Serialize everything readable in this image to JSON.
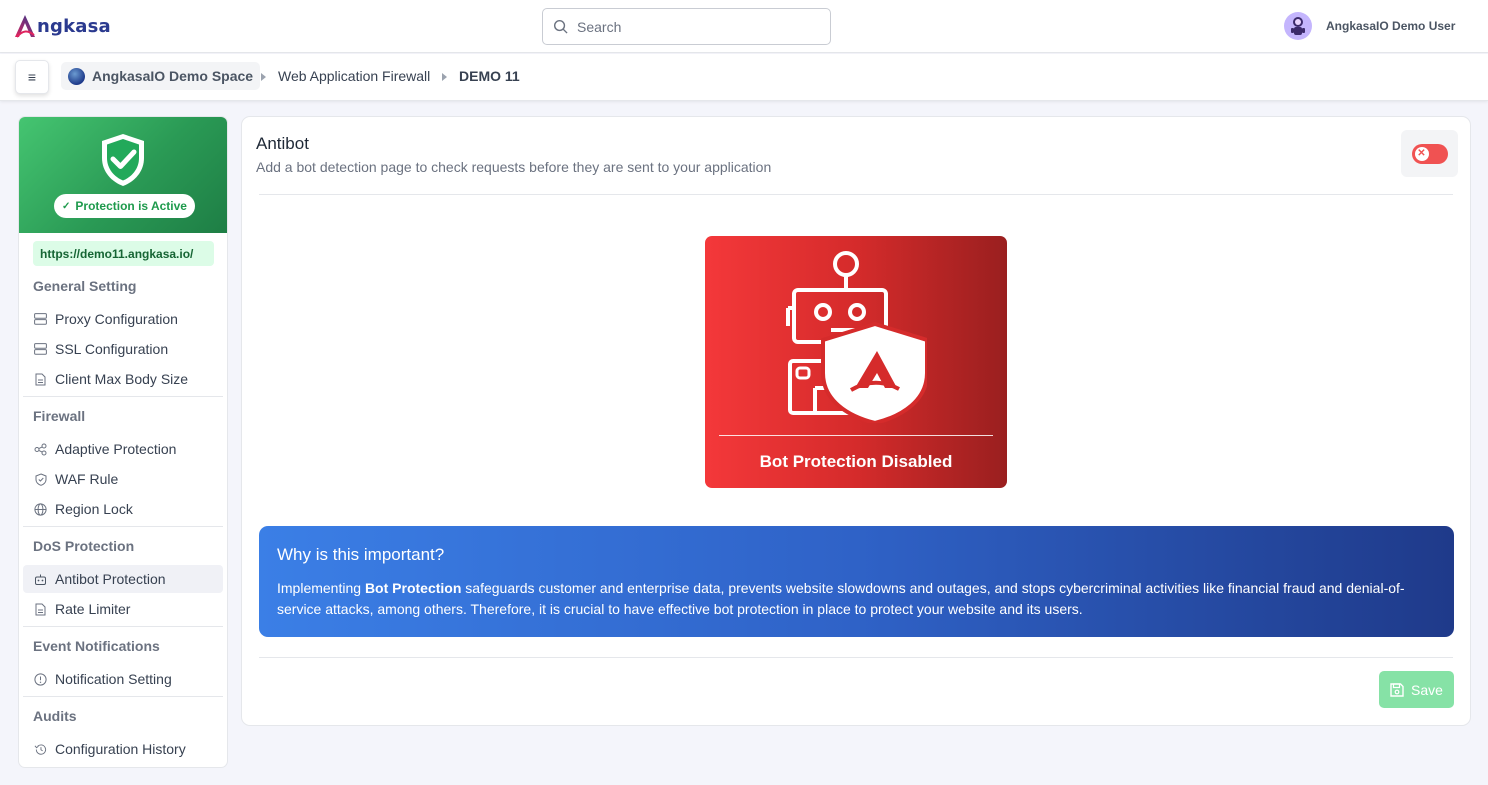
{
  "app": {
    "brand": "ngkasa",
    "search_placeholder": "Search",
    "user_name": "AngkasaIO Demo User"
  },
  "breadcrumb": {
    "space": "AngkasaIO Demo Space",
    "section": "Web Application Firewall",
    "current": "DEMO 11"
  },
  "sidebar": {
    "status": "Protection is Active",
    "url": "https://demo11.angkasa.io/",
    "sections": [
      {
        "title": "General Setting",
        "items": [
          "Proxy Configuration",
          "SSL Configuration",
          "Client Max Body Size"
        ]
      },
      {
        "title": "Firewall",
        "items": [
          "Adaptive Protection",
          "WAF Rule",
          "Region Lock"
        ]
      },
      {
        "title": "DoS Protection",
        "items": [
          "Antibot Protection",
          "Rate Limiter"
        ]
      },
      {
        "title": "Event Notifications",
        "items": [
          "Notification Setting"
        ]
      },
      {
        "title": "Audits",
        "items": [
          "Configuration History"
        ]
      }
    ],
    "active_item": "Antibot Protection"
  },
  "main": {
    "title": "Antibot",
    "subtitle": "Add a bot detection page to check requests before they are sent to your application",
    "toggle_enabled": false,
    "bot_status": "Bot Protection Disabled",
    "info_title": "Why is this important?",
    "info_text_prefix": "Implementing ",
    "info_text_bold": "Bot Protection",
    "info_text_rest": " safeguards customer and enterprise data, prevents website slowdowns and outages, and stops cybercriminal activities like financial fraud and denial-of-service attacks, among others. Therefore, it is crucial to have effective bot protection in place to protect your website and its users.",
    "save_label": "Save"
  },
  "colors": {
    "brand": "#2b3a8f",
    "active_green": "#2a9a55",
    "disabled_red": "#f05252",
    "info_blue": "#2f62c7",
    "save_green": "#86e2a6"
  }
}
